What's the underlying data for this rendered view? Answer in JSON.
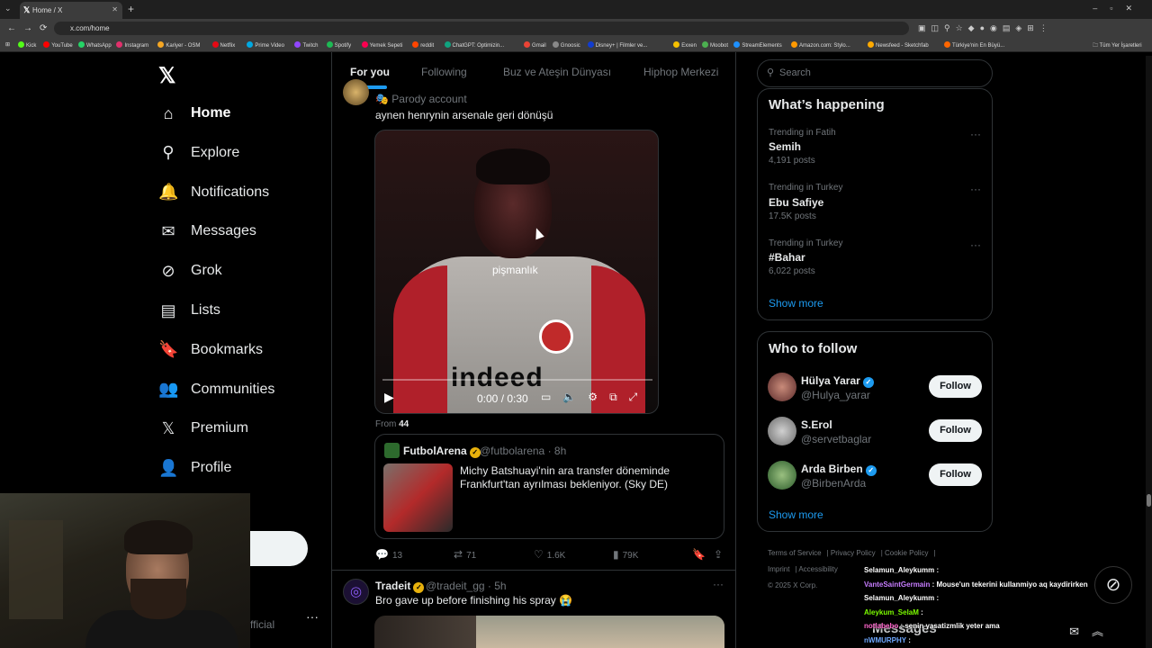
{
  "browser": {
    "tab_title": "Home / X",
    "url": "x.com/home",
    "bookmarks": [
      "Kick",
      "YouTube",
      "WhatsApp",
      "Instagram",
      "Kariyer - OSM",
      "Netflix",
      "Prime Video",
      "Twitch",
      "Spotify",
      "Yemek Sepeti",
      "reddit",
      "ChatGPT: Optimizin...",
      "Gmail",
      "Gnoosic",
      "Disney+ | Filmler ve...",
      "Exxen",
      "Moobot",
      "StreamElements",
      "Amazon.com: Stylo...",
      "Newsfeed - Sketchfab",
      "Türkiye'nin En Büyü..."
    ],
    "bookmarks_other": "Tüm Yer İşaretleri"
  },
  "sidebar": {
    "items": [
      {
        "label": "Home",
        "icon": "home-icon"
      },
      {
        "label": "Explore",
        "icon": "search-icon"
      },
      {
        "label": "Notifications",
        "icon": "bell-icon"
      },
      {
        "label": "Messages",
        "icon": "envelope-icon"
      },
      {
        "label": "Grok",
        "icon": "grok-icon"
      },
      {
        "label": "Lists",
        "icon": "list-icon"
      },
      {
        "label": "Bookmarks",
        "icon": "bookmark-icon"
      },
      {
        "label": "Communities",
        "icon": "communities-icon"
      },
      {
        "label": "Premium",
        "icon": "x-logo-icon"
      },
      {
        "label": "Profile",
        "icon": "person-icon"
      }
    ],
    "account_fragment": "fficial"
  },
  "feed": {
    "tabs": [
      "For you",
      "Following",
      "Buz ve Ateşin Dünyası",
      "Hiphop Merkezi"
    ],
    "tweet1": {
      "parody_label": "Parody account",
      "text": "aynen henrynin arsenale geri dönüşü",
      "video_caption": "pişmanlık",
      "video_sponsor": "indeed",
      "video_time": "0:00 / 0:30",
      "from_label": "From",
      "from_source": "44",
      "quote": {
        "name": "FutbolArena",
        "handle": "@futbolarena · 8h",
        "text": "Michy Batshuayi'nin ara transfer döneminde Frankfurt'tan ayrılması bekleniyor. (Sky DE)"
      },
      "actions": {
        "replies": "13",
        "reposts": "71",
        "likes": "1.6K",
        "views": "79K"
      }
    },
    "tweet2": {
      "name": "Tradeit",
      "handle": "@tradeit_gg · 5h",
      "text": "Bro gave up before finishing his spray 😭"
    }
  },
  "right": {
    "search_placeholder": "Search",
    "whats_happening": {
      "title": "What’s happening",
      "trends": [
        {
          "context": "Trending in Fatih",
          "name": "Semih",
          "count": "4,191 posts"
        },
        {
          "context": "Trending in Turkey",
          "name": "Ebu Safiye",
          "count": "17.5K posts"
        },
        {
          "context": "Trending in Turkey",
          "name": "#Bahar",
          "count": "6,022 posts"
        }
      ],
      "show_more": "Show more"
    },
    "who_to_follow": {
      "title": "Who to follow",
      "users": [
        {
          "name": "Hülya Yarar",
          "handle": "@Hulya_yarar",
          "button": "Follow"
        },
        {
          "name": "S.Erol",
          "handle": "@servetbaglar",
          "button": "Follow"
        },
        {
          "name": "Arda Birben",
          "handle": "@BirbenArda",
          "button": "Follow"
        }
      ],
      "show_more": "Show more"
    },
    "footer": [
      "Terms of Service",
      "Privacy Policy",
      "Cookie Policy",
      "Imprint",
      "Accessibility",
      "© 2025 X Corp."
    ]
  },
  "chat": [
    {
      "user": "Selamun_Aleykumm",
      "msg": "",
      "color": "#ffffff"
    },
    {
      "user": "VanteSaintGermain",
      "msg": "Mouse'un tekerini kullanmiyo aq kaydirirken",
      "color": "#c77dff"
    },
    {
      "user": "Selamun_Aleykumm",
      "msg": "",
      "color": "#ffffff"
    },
    {
      "user": "Aleykum_SelaM",
      "msg": "",
      "color": "#7CFC00"
    },
    {
      "user": "notlabebo",
      "msg": "senin yasatizmlik yeter ama",
      "color": "#ff66cc"
    },
    {
      "user": "nWMURPHY",
      "msg": "",
      "color": "#6fa8ff"
    }
  ],
  "messages_drawer": {
    "title": "Messages"
  },
  "colors": {
    "accent": "#1d9bf0",
    "background": "#000000",
    "border": "#2f3336",
    "muted": "#71767b"
  }
}
